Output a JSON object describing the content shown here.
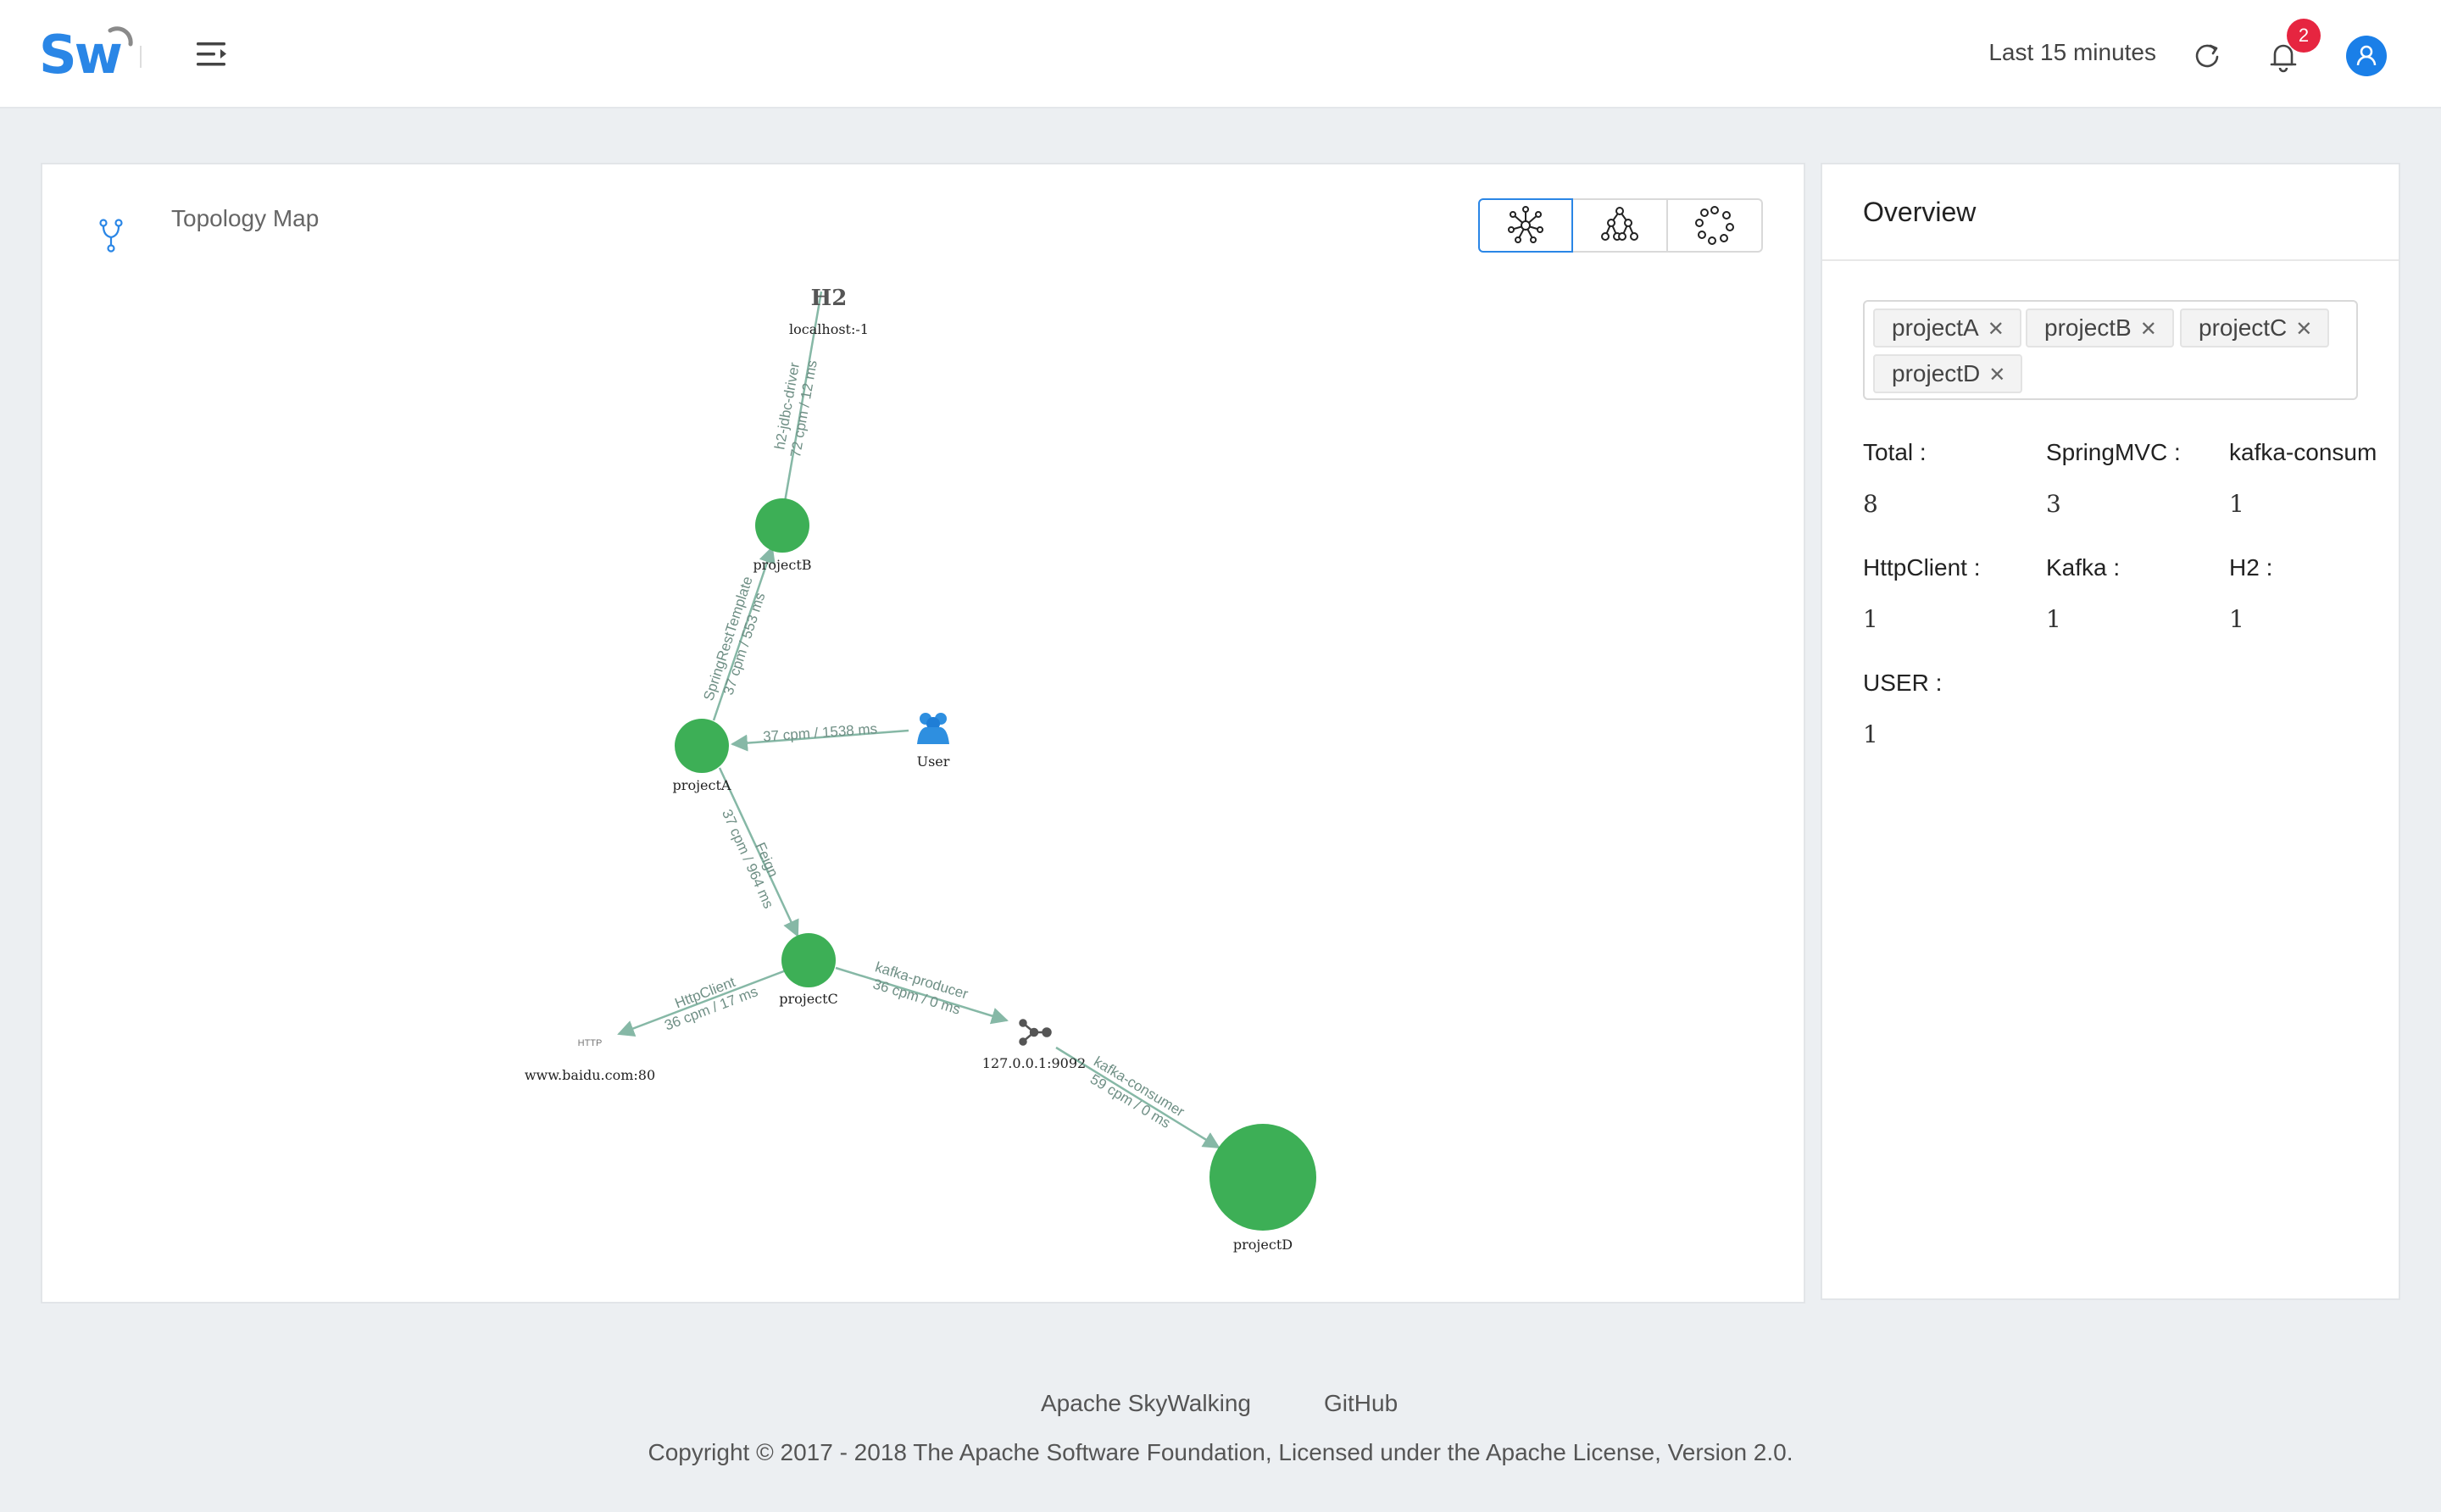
{
  "header": {
    "logo_text": "Sw",
    "time_range": "Last 15 minutes",
    "notification_count": "2"
  },
  "topology": {
    "title": "Topology Map",
    "layout_modes": [
      "Force layout",
      "Hierarchy layout",
      "Circle layout"
    ],
    "nodes": {
      "h2_title": "H2",
      "h2_label": "localhost:-1",
      "projectB": "projectB",
      "projectA": "projectA",
      "user": "User",
      "projectC": "projectC",
      "http_icon_text": "HTTP",
      "http_label": "www.baidu.com:80",
      "kafka_label": "127.0.0.1:9092",
      "projectD": "projectD"
    },
    "edges": {
      "b_h2_type": "h2-jdbc-driver",
      "b_h2_stats": "72 cpm / 12 ms",
      "a_b_type": "SpringRestTemplate",
      "a_b_stats": "37 cpm / 553 ms",
      "user_a": "37 cpm / 1538 ms",
      "a_c_type": "Feign",
      "a_c_stats": "37 cpm / 964 ms",
      "c_http_type": "HttpClient",
      "c_http_stats": "36 cpm / 17 ms",
      "c_kafka_type": "kafka-producer",
      "c_kafka_stats": "36 cpm / 0 ms",
      "kafka_d_type": "kafka-consumer",
      "kafka_d_stats": "59 cpm / 0 ms"
    }
  },
  "overview": {
    "title": "Overview",
    "selected_projects": [
      "projectA",
      "projectB",
      "projectC",
      "projectD"
    ],
    "stats": [
      {
        "label": "Total :",
        "value": "8"
      },
      {
        "label": "SpringMVC :",
        "value": "3"
      },
      {
        "label": "kafka-consum",
        "value": "1"
      },
      {
        "label": "HttpClient :",
        "value": "1"
      },
      {
        "label": "Kafka :",
        "value": "1"
      },
      {
        "label": "H2 :",
        "value": "1"
      },
      {
        "label": "USER :",
        "value": "1"
      }
    ]
  },
  "footer": {
    "link_skywalking": "Apache SkyWalking",
    "link_github": "GitHub",
    "copyright": "Copyright © 2017 - 2018 The Apache Software Foundation, Licensed under the Apache License, Version 2.0."
  },
  "colors": {
    "accent": "#2a86e6",
    "node_green": "#3daf56",
    "edge": "#86b8a6",
    "badge_red": "#e62540"
  }
}
